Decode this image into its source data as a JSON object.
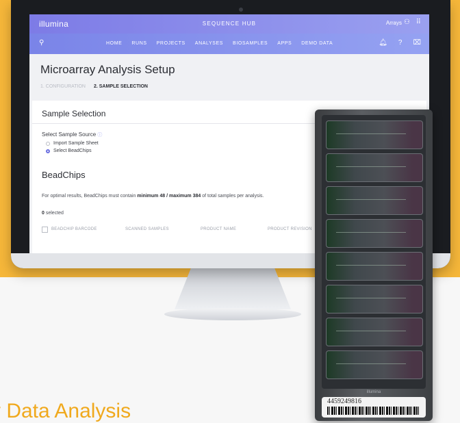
{
  "app": {
    "brand": "illumina",
    "hub_title": "SEQUENCE HUB",
    "user_label": "Arrays"
  },
  "nav": {
    "items": [
      "HOME",
      "RUNS",
      "PROJECTS",
      "ANALYSES",
      "BIOSAMPLES",
      "APPS",
      "DEMO DATA"
    ]
  },
  "page": {
    "title": "Microarray Analysis Setup",
    "steps": [
      "1. CONFIGURATION",
      "2. SAMPLE SELECTION"
    ]
  },
  "sample_selection": {
    "heading": "Sample Selection",
    "source_label": "Select Sample Source",
    "options": [
      "Import Sample Sheet",
      "Select BeadChips"
    ],
    "selected_option": "Select BeadChips"
  },
  "beadchips": {
    "heading": "BeadChips",
    "note_prefix": "For optimal results, BeadChips must contain ",
    "note_bold": "minimum 48 / maximum 384",
    "note_suffix": " of total samples per analysis.",
    "selected_count": "0",
    "selected_suffix": " selected",
    "columns": [
      "BEADCHIP BARCODE",
      "SCANNED SAMPLES",
      "PRODUCT NAME",
      "PRODUCT REVISION"
    ]
  },
  "chip": {
    "brand": "illumina",
    "barcode": "4459249816"
  },
  "caption": "y Data Analysis",
  "colors": {
    "background_orange": "#f6b73a",
    "header_purple": "#7d7be6",
    "accent_orange_text": "#f0a91d"
  },
  "icons": [
    "search-icon",
    "user-icon",
    "apps-grid-icon",
    "bell-icon",
    "help-icon",
    "trash-icon"
  ]
}
